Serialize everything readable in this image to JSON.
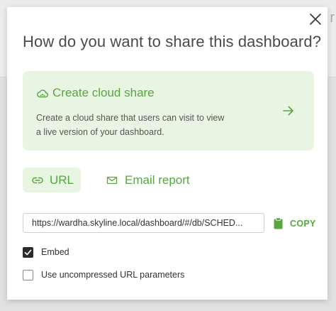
{
  "backdrop": {
    "peek_text": "r"
  },
  "modal": {
    "title": "How do you want to share this dashboard?",
    "close_icon": "close-icon"
  },
  "cloud_share": {
    "icon": "cloud-share-icon",
    "title": "Create cloud share",
    "description_line1": "Create a cloud share that users can visit to view",
    "description_line2": "a live version of your dashboard.",
    "arrow_icon": "arrow-right-icon"
  },
  "tabs": [
    {
      "label": "URL",
      "icon": "link-icon",
      "selected": true
    },
    {
      "label": "Email report",
      "icon": "envelope-icon",
      "selected": false
    }
  ],
  "url_field": {
    "value": "https://wardha.skyline.local/dashboard/#/db/SCHED..."
  },
  "copy": {
    "label": "COPY",
    "icon": "clipboard-icon"
  },
  "options": [
    {
      "label": "Embed",
      "checked": true
    },
    {
      "label": "Use uncompressed URL parameters",
      "checked": false
    }
  ],
  "colors": {
    "accent_green": "#58a640",
    "card_background": "#e8f5e2",
    "checkbox_checked": "#2b2b2b"
  }
}
